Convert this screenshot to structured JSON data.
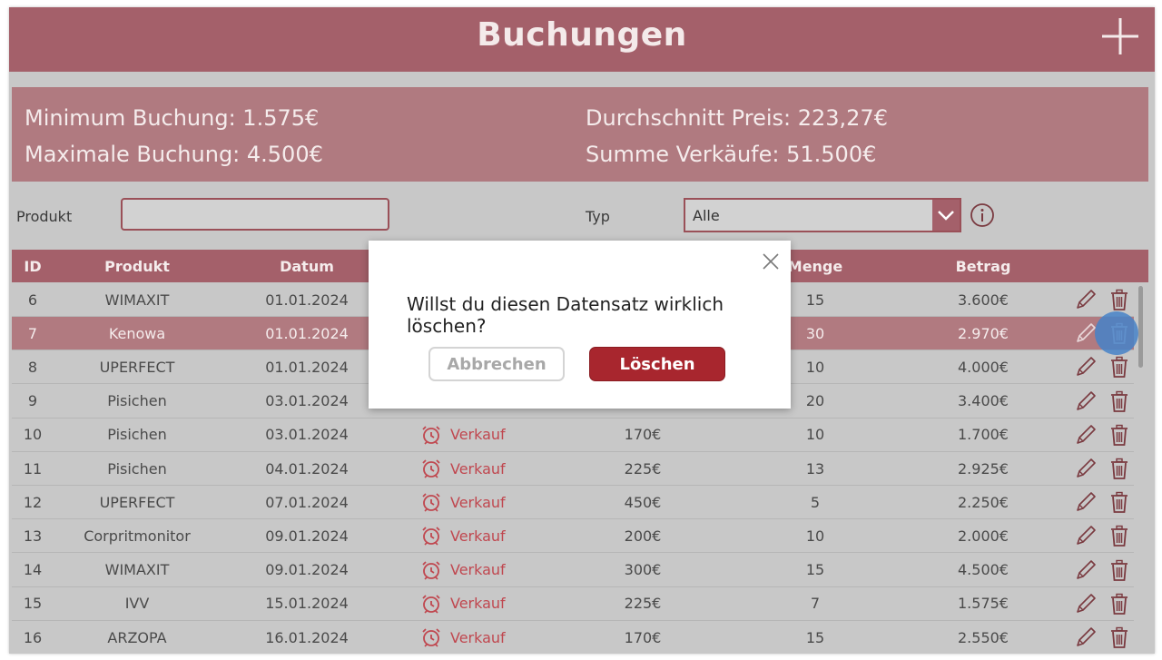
{
  "header": {
    "title": "Buchungen"
  },
  "stats": {
    "min": "Minimum Buchung: 1.575€",
    "max": "Maximale Buchung: 4.500€",
    "avg": "Durchschnitt Preis: 223,27€",
    "sum": "Summe Verkäufe: 51.500€"
  },
  "filters": {
    "produkt_label": "Produkt",
    "produkt_value": "",
    "typ_label": "Typ",
    "typ_value": "Alle"
  },
  "table": {
    "headers": {
      "id": "ID",
      "produkt": "Produkt",
      "datum": "Datum",
      "menge": "Menge",
      "betrag": "Betrag"
    },
    "rows": [
      {
        "id": "6",
        "produkt": "WIMAXIT",
        "datum": "01.01.2024",
        "typ": "",
        "preis": "",
        "menge": "15",
        "betrag": "3.600€"
      },
      {
        "id": "7",
        "produkt": "Kenowa",
        "datum": "01.01.2024",
        "typ": "",
        "preis": "",
        "menge": "30",
        "betrag": "2.970€"
      },
      {
        "id": "8",
        "produkt": "UPERFECT",
        "datum": "01.01.2024",
        "typ": "",
        "preis": "",
        "menge": "10",
        "betrag": "4.000€"
      },
      {
        "id": "9",
        "produkt": "Pisichen",
        "datum": "03.01.2024",
        "typ": "",
        "preis": "",
        "menge": "20",
        "betrag": "3.400€"
      },
      {
        "id": "10",
        "produkt": "Pisichen",
        "datum": "03.01.2024",
        "typ": "Verkauf",
        "preis": "170€",
        "menge": "10",
        "betrag": "1.700€"
      },
      {
        "id": "11",
        "produkt": "Pisichen",
        "datum": "04.01.2024",
        "typ": "Verkauf",
        "preis": "225€",
        "menge": "13",
        "betrag": "2.925€"
      },
      {
        "id": "12",
        "produkt": "UPERFECT",
        "datum": "07.01.2024",
        "typ": "Verkauf",
        "preis": "450€",
        "menge": "5",
        "betrag": "2.250€"
      },
      {
        "id": "13",
        "produkt": "Corpritmonitor",
        "datum": "09.01.2024",
        "typ": "Verkauf",
        "preis": "200€",
        "menge": "10",
        "betrag": "2.000€"
      },
      {
        "id": "14",
        "produkt": "WIMAXIT",
        "datum": "09.01.2024",
        "typ": "Verkauf",
        "preis": "300€",
        "menge": "15",
        "betrag": "4.500€"
      },
      {
        "id": "15",
        "produkt": "IVV",
        "datum": "15.01.2024",
        "typ": "Verkauf",
        "preis": "225€",
        "menge": "7",
        "betrag": "1.575€"
      },
      {
        "id": "16",
        "produkt": "ARZOPA",
        "datum": "16.01.2024",
        "typ": "Verkauf",
        "preis": "170€",
        "menge": "15",
        "betrag": "2.550€"
      }
    ],
    "selected_id": "7"
  },
  "dialog": {
    "message": "Willst du diesen Datensatz wirklich löschen?",
    "cancel_label": "Abbrechen",
    "delete_label": "Löschen"
  },
  "colors": {
    "header": "#a4606a",
    "stats_bg": "#b07a80",
    "accent_red": "#c0474f",
    "delete_button": "#a8262e",
    "background": "#c8c8c8"
  },
  "icons": {
    "add": "plus-icon",
    "info": "info-icon",
    "dropdown": "chevron-down-icon",
    "type": "alarm-clock-icon",
    "edit": "pencil-icon",
    "delete": "trash-icon",
    "close": "close-icon"
  }
}
